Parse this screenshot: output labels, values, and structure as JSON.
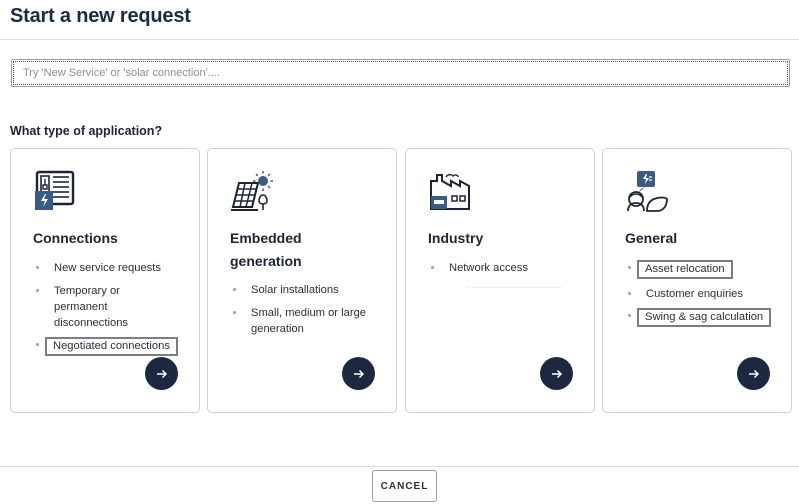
{
  "header": {
    "title": "Start a new request"
  },
  "search": {
    "placeholder": "Try 'New Service' or 'solar connection'...."
  },
  "question": "What type of application?",
  "cards": [
    {
      "title": "Connections",
      "icon": "electrical-panel-icon",
      "items": [
        "New service requests",
        "Temporary or permanent disconnections",
        "Negotiated connections"
      ]
    },
    {
      "title": "Embedded generation",
      "icon": "solar-panel-icon",
      "items": [
        "Solar installations",
        "Small, medium or large generation"
      ]
    },
    {
      "title": "Industry",
      "icon": "factory-icon",
      "items": [
        "Network access"
      ]
    },
    {
      "title": "General",
      "icon": "general-enquiry-icon",
      "items": [
        "Asset relocation",
        "Customer enquiries",
        "Swing & sag calculation"
      ]
    }
  ],
  "footer": {
    "cancel_label": "CANCEL"
  },
  "colors": {
    "accent": "#1d2840",
    "icon_blue": "#3a5b84",
    "border": "#c9cfd8"
  }
}
